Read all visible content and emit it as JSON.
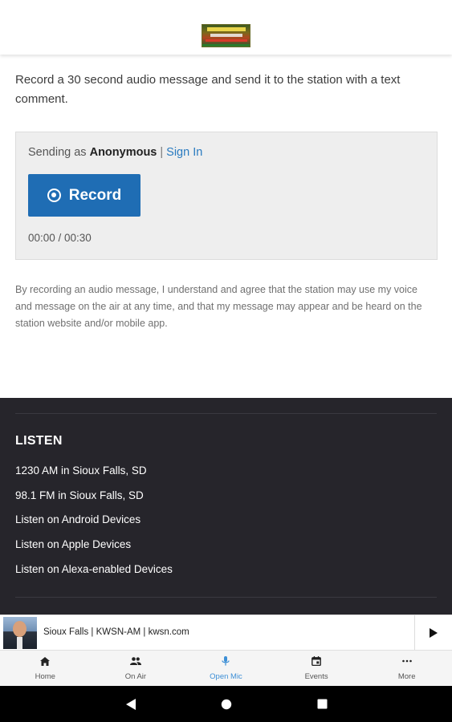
{
  "header": {
    "logo_alt": "station-logo"
  },
  "intro": {
    "text": "Record a 30 second audio message and send it to the station with a text comment."
  },
  "recorder": {
    "sending_prefix": "Sending as",
    "sending_name": "Anonymous",
    "separator": "|",
    "sign_in_label": "Sign In",
    "record_label": "Record",
    "timer": "00:00 / 00:30"
  },
  "disclaimer": {
    "text": "By recording an audio message, I understand and agree that the station may use my voice and message on the air at any time, and that my message may appear and be heard on the station website and/or mobile app."
  },
  "footer": {
    "heading": "LISTEN",
    "links": [
      "1230 AM in Sioux Falls, SD",
      "98.1 FM in Sioux Falls, SD",
      "Listen on Android Devices",
      "Listen on Apple Devices",
      "Listen on Alexa-enabled Devices"
    ]
  },
  "player": {
    "title": "Sioux Falls | KWSN-AM | kwsn.com",
    "play_icon": "play-icon"
  },
  "tabbar": {
    "tabs": [
      {
        "label": "Home",
        "icon": "home-icon",
        "active": false
      },
      {
        "label": "On Air",
        "icon": "people-icon",
        "active": false
      },
      {
        "label": "Open Mic",
        "icon": "microphone-icon",
        "active": true
      },
      {
        "label": "Events",
        "icon": "calendar-icon",
        "active": false
      },
      {
        "label": "More",
        "icon": "more-dots-icon",
        "active": false
      }
    ]
  },
  "colors": {
    "accent": "#1f6db4",
    "link": "#2a7bc0",
    "active_tab": "#3d8fd6",
    "footer_bg": "#26252b"
  }
}
